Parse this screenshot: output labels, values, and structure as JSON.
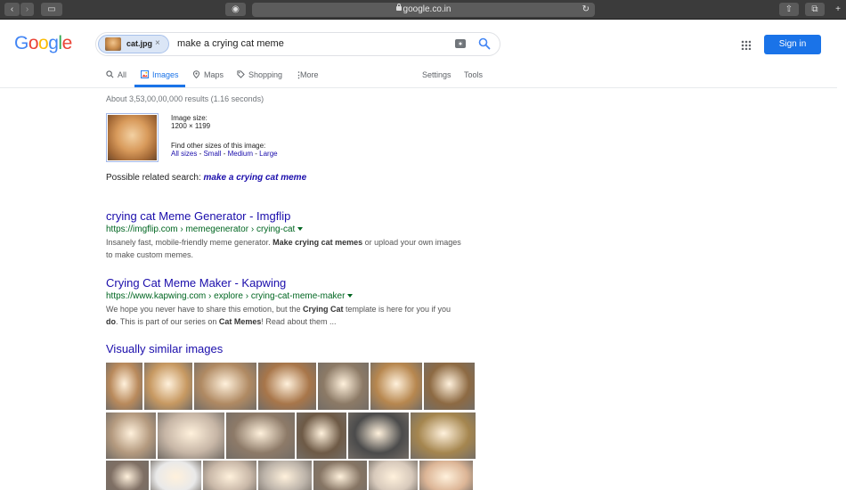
{
  "browser": {
    "url": "google.co.in"
  },
  "logo": "Google",
  "search": {
    "chip_label": "cat.jpg",
    "chip_remove": "×",
    "query": "make a crying cat meme"
  },
  "header": {
    "sign_in": "Sign in"
  },
  "tabs": [
    {
      "label": "All"
    },
    {
      "label": "Images"
    },
    {
      "label": "Maps"
    },
    {
      "label": "Shopping"
    },
    {
      "label": "More"
    }
  ],
  "tools": {
    "settings": "Settings",
    "tools": "Tools"
  },
  "stats": "About 3,53,00,00,000 results (1.16 seconds)",
  "query_image": {
    "size_label": "Image size:",
    "size_value": "1200 × 1199",
    "other_sizes_label": "Find other sizes of this image:",
    "sizes": [
      "All sizes",
      "Small",
      "Medium",
      "Large"
    ],
    "separator": " - "
  },
  "related": {
    "prefix": "Possible related search: ",
    "link": "make a crying cat meme"
  },
  "results": [
    {
      "title": "crying cat Meme Generator - Imgflip",
      "url": "https://imgflip.com › memegenerator › crying-cat",
      "snippet_parts": [
        {
          "t": "Insanely fast, mobile-friendly meme generator. ",
          "b": false
        },
        {
          "t": "Make crying cat memes",
          "b": true
        },
        {
          "t": " or upload your own images to make custom memes.",
          "b": false
        }
      ]
    },
    {
      "title": "Crying Cat Meme Maker - Kapwing",
      "url": "https://www.kapwing.com › explore › crying-cat-meme-maker",
      "snippet_parts": [
        {
          "t": "We hope you never have to share this emotion, but the ",
          "b": false
        },
        {
          "t": "Crying Cat",
          "b": true
        },
        {
          "t": " template is here for you if you ",
          "b": false
        },
        {
          "t": "do",
          "b": true
        },
        {
          "t": ". This is part of our series on ",
          "b": false
        },
        {
          "t": "Cat Memes",
          "b": true
        },
        {
          "t": "! Read about them ...",
          "b": false
        }
      ]
    }
  ],
  "visually_similar": {
    "title": "Visually similar images",
    "thumbnails": [
      {
        "color": "#b98a5c"
      },
      {
        "color": "#c79962"
      },
      {
        "color": "#b08a63"
      },
      {
        "color": "#a8764a"
      },
      {
        "color": "#8c7a66"
      },
      {
        "color": "#b7874f"
      },
      {
        "color": "#8d6a43"
      },
      {
        "color": "#b49a7f"
      },
      {
        "color": "#c7b6a6"
      },
      {
        "color": "#8d7a68"
      },
      {
        "color": "#6e5a46"
      },
      {
        "color": "#4b4b4b"
      },
      {
        "color": "#a5864f"
      },
      {
        "color": "#7f6f64"
      },
      {
        "color": "#e9e9e9"
      },
      {
        "color": "#c9b8a8"
      },
      {
        "color": "#bdb4aa"
      },
      {
        "color": "#867564"
      },
      {
        "color": "#d7c9bb"
      },
      {
        "color": "#dcb596"
      }
    ]
  },
  "colors": {
    "accent": "#1a73e8",
    "link": "#1a0dab",
    "url_green": "#006621"
  }
}
